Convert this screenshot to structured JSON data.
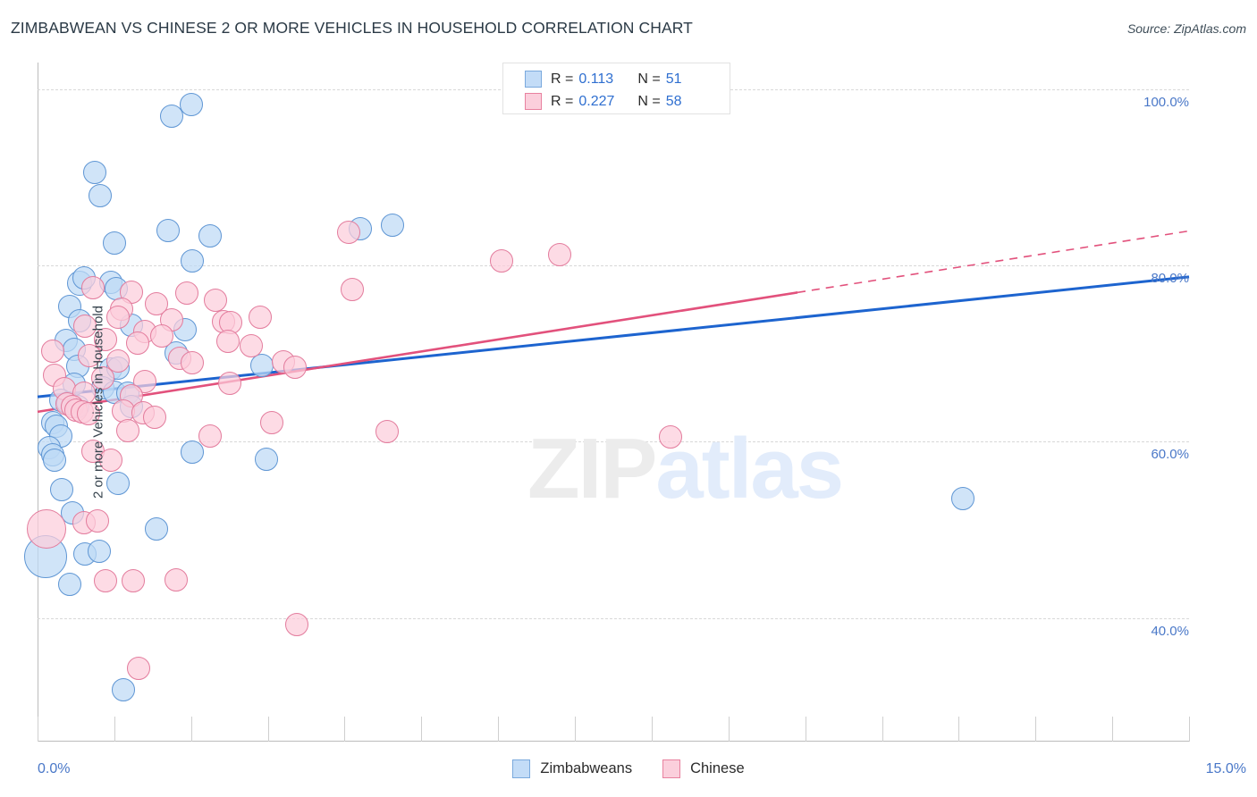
{
  "header": {
    "title": "ZIMBABWEAN VS CHINESE 2 OR MORE VEHICLES IN HOUSEHOLD CORRELATION CHART",
    "source": "Source: ZipAtlas.com"
  },
  "watermark": {
    "part1": "ZIP",
    "part2": "atlas"
  },
  "stats": {
    "rows": [
      {
        "series": "Zimbabweans",
        "r_label": "R =",
        "r_value": "0.113",
        "n_label": "N =",
        "n_value": "51",
        "color": "#c3dcf7"
      },
      {
        "series": "Chinese",
        "r_label": "R =",
        "r_value": "0.227",
        "n_label": "N =",
        "n_value": "58",
        "color": "#fbcfdc"
      }
    ]
  },
  "legend": {
    "items": [
      {
        "label": "Zimbabweans",
        "color": "#c3dcf7",
        "border": "#7aa9dd"
      },
      {
        "label": "Chinese",
        "color": "#fbcfdc",
        "border": "#e8819f"
      }
    ]
  },
  "axes": {
    "x_min_label": "0.0%",
    "x_max_label": "15.0%",
    "y_title": "2 or more Vehicles in Household",
    "y_ticks": [
      "100.0%",
      "80.0%",
      "60.0%",
      "40.0%"
    ]
  },
  "chart_data": {
    "type": "scatter",
    "title": "ZIMBABWEAN VS CHINESE 2 OR MORE VEHICLES IN HOUSEHOLD CORRELATION CHART",
    "xlabel": "",
    "ylabel": "2 or more Vehicles in Household",
    "xlim": [
      0.0,
      15.0
    ],
    "ylim": [
      26.0,
      103.0
    ],
    "x_tick_labels": [
      "0.0%",
      "15.0%"
    ],
    "y_tick_labels": [
      "40.0%",
      "60.0%",
      "80.0%",
      "100.0%"
    ],
    "y_tick_values": [
      40.0,
      60.0,
      80.0,
      100.0
    ],
    "grid": "horizontal-dashed",
    "legend_position": "bottom-center",
    "colors": {
      "zimbabweans_fill": "#bed9f5",
      "zimbabweans_stroke": "#5f96d4",
      "chinese_fill": "#fccddb",
      "chinese_stroke": "#e37c9d"
    },
    "series": [
      {
        "name": "Zimbabweans",
        "r": 0.113,
        "n": 51,
        "trendline": {
          "color": "#1d64cf",
          "x0": 0.0,
          "y0": 65.1,
          "x1": 15.0,
          "y1": 78.7,
          "style": "solid"
        },
        "points": [
          {
            "x": 1.75,
            "y": 96.9,
            "r": 13
          },
          {
            "x": 2.0,
            "y": 98.2,
            "r": 13
          },
          {
            "x": 0.75,
            "y": 90.5,
            "r": 13
          },
          {
            "x": 0.82,
            "y": 87.9,
            "r": 13
          },
          {
            "x": 1.7,
            "y": 84.0,
            "r": 13
          },
          {
            "x": 1.0,
            "y": 82.5,
            "r": 13
          },
          {
            "x": 2.25,
            "y": 83.3,
            "r": 13
          },
          {
            "x": 4.2,
            "y": 84.2,
            "r": 13
          },
          {
            "x": 4.62,
            "y": 84.6,
            "r": 13
          },
          {
            "x": 2.02,
            "y": 80.5,
            "r": 13
          },
          {
            "x": 0.55,
            "y": 78.0,
            "r": 14
          },
          {
            "x": 0.6,
            "y": 78.6,
            "r": 13
          },
          {
            "x": 0.95,
            "y": 78.1,
            "r": 13
          },
          {
            "x": 1.02,
            "y": 77.4,
            "r": 13
          },
          {
            "x": 0.42,
            "y": 75.3,
            "r": 13
          },
          {
            "x": 0.55,
            "y": 73.7,
            "r": 13
          },
          {
            "x": 1.22,
            "y": 73.2,
            "r": 13
          },
          {
            "x": 1.92,
            "y": 72.7,
            "r": 13
          },
          {
            "x": 0.37,
            "y": 71.5,
            "r": 13
          },
          {
            "x": 0.48,
            "y": 70.5,
            "r": 13
          },
          {
            "x": 1.8,
            "y": 70.1,
            "r": 13
          },
          {
            "x": 0.52,
            "y": 68.6,
            "r": 13
          },
          {
            "x": 0.95,
            "y": 68.2,
            "r": 13
          },
          {
            "x": 1.05,
            "y": 68.4,
            "r": 13
          },
          {
            "x": 2.92,
            "y": 68.7,
            "r": 13
          },
          {
            "x": 0.48,
            "y": 66.5,
            "r": 13
          },
          {
            "x": 0.85,
            "y": 66.1,
            "r": 13
          },
          {
            "x": 1.0,
            "y": 65.6,
            "r": 13
          },
          {
            "x": 1.18,
            "y": 65.5,
            "r": 13
          },
          {
            "x": 0.3,
            "y": 64.7,
            "r": 13
          },
          {
            "x": 0.4,
            "y": 64.4,
            "r": 13
          },
          {
            "x": 0.52,
            "y": 64.0,
            "r": 13
          },
          {
            "x": 1.22,
            "y": 64.0,
            "r": 13
          },
          {
            "x": 0.2,
            "y": 62.2,
            "r": 13
          },
          {
            "x": 0.25,
            "y": 61.8,
            "r": 13
          },
          {
            "x": 0.3,
            "y": 60.7,
            "r": 13
          },
          {
            "x": 0.15,
            "y": 59.3,
            "r": 13
          },
          {
            "x": 0.2,
            "y": 58.5,
            "r": 13
          },
          {
            "x": 0.22,
            "y": 57.9,
            "r": 13
          },
          {
            "x": 2.02,
            "y": 58.8,
            "r": 13
          },
          {
            "x": 2.98,
            "y": 58.0,
            "r": 13
          },
          {
            "x": 0.32,
            "y": 54.6,
            "r": 13
          },
          {
            "x": 1.05,
            "y": 55.3,
            "r": 13
          },
          {
            "x": 0.45,
            "y": 51.9,
            "r": 13
          },
          {
            "x": 1.55,
            "y": 50.1,
            "r": 13
          },
          {
            "x": 0.1,
            "y": 47.0,
            "r": 24
          },
          {
            "x": 0.62,
            "y": 47.3,
            "r": 13
          },
          {
            "x": 0.8,
            "y": 47.6,
            "r": 13
          },
          {
            "x": 0.42,
            "y": 43.8,
            "r": 13
          },
          {
            "x": 1.12,
            "y": 31.9,
            "r": 13
          },
          {
            "x": 12.05,
            "y": 53.6,
            "r": 13
          }
        ]
      },
      {
        "name": "Chinese",
        "r": 0.227,
        "n": 58,
        "trendline": {
          "color": "#e2517c",
          "x0": 0.0,
          "y0": 63.4,
          "x1": 15.0,
          "y1": 83.9,
          "style": "solid-then-dashed",
          "dash_start_x": 9.9
        },
        "points": [
          {
            "x": 4.05,
            "y": 83.8,
            "r": 13
          },
          {
            "x": 6.05,
            "y": 80.5,
            "r": 13
          },
          {
            "x": 6.8,
            "y": 81.2,
            "r": 13
          },
          {
            "x": 4.1,
            "y": 77.3,
            "r": 13
          },
          {
            "x": 0.72,
            "y": 77.5,
            "r": 13
          },
          {
            "x": 1.22,
            "y": 77.0,
            "r": 13
          },
          {
            "x": 1.95,
            "y": 76.9,
            "r": 13
          },
          {
            "x": 2.32,
            "y": 76.0,
            "r": 13
          },
          {
            "x": 1.55,
            "y": 75.6,
            "r": 13
          },
          {
            "x": 1.1,
            "y": 75.0,
            "r": 13
          },
          {
            "x": 1.05,
            "y": 74.1,
            "r": 13
          },
          {
            "x": 1.75,
            "y": 73.8,
            "r": 13
          },
          {
            "x": 2.42,
            "y": 73.6,
            "r": 13
          },
          {
            "x": 2.52,
            "y": 73.5,
            "r": 13
          },
          {
            "x": 2.9,
            "y": 74.1,
            "r": 13
          },
          {
            "x": 0.62,
            "y": 73.1,
            "r": 13
          },
          {
            "x": 1.4,
            "y": 72.5,
            "r": 13
          },
          {
            "x": 1.62,
            "y": 72.0,
            "r": 13
          },
          {
            "x": 0.88,
            "y": 71.6,
            "r": 13
          },
          {
            "x": 1.3,
            "y": 71.2,
            "r": 13
          },
          {
            "x": 2.48,
            "y": 71.4,
            "r": 13
          },
          {
            "x": 2.78,
            "y": 70.9,
            "r": 13
          },
          {
            "x": 0.2,
            "y": 70.3,
            "r": 13
          },
          {
            "x": 0.68,
            "y": 69.8,
            "r": 13
          },
          {
            "x": 1.05,
            "y": 69.2,
            "r": 13
          },
          {
            "x": 1.85,
            "y": 69.5,
            "r": 13
          },
          {
            "x": 2.02,
            "y": 69.0,
            "r": 13
          },
          {
            "x": 3.2,
            "y": 69.1,
            "r": 13
          },
          {
            "x": 3.35,
            "y": 68.5,
            "r": 13
          },
          {
            "x": 0.22,
            "y": 67.5,
            "r": 13
          },
          {
            "x": 0.85,
            "y": 67.2,
            "r": 13
          },
          {
            "x": 1.4,
            "y": 66.8,
            "r": 13
          },
          {
            "x": 2.5,
            "y": 66.6,
            "r": 13
          },
          {
            "x": 0.35,
            "y": 66.0,
            "r": 13
          },
          {
            "x": 0.6,
            "y": 65.5,
            "r": 13
          },
          {
            "x": 1.22,
            "y": 65.2,
            "r": 13
          },
          {
            "x": 0.38,
            "y": 64.3,
            "r": 13
          },
          {
            "x": 0.45,
            "y": 64.0,
            "r": 13
          },
          {
            "x": 0.5,
            "y": 63.6,
            "r": 13
          },
          {
            "x": 0.58,
            "y": 63.4,
            "r": 13
          },
          {
            "x": 0.66,
            "y": 63.2,
            "r": 13
          },
          {
            "x": 1.12,
            "y": 63.5,
            "r": 13
          },
          {
            "x": 1.38,
            "y": 63.3,
            "r": 13
          },
          {
            "x": 1.52,
            "y": 62.8,
            "r": 13
          },
          {
            "x": 3.05,
            "y": 62.2,
            "r": 13
          },
          {
            "x": 1.18,
            "y": 61.3,
            "r": 13
          },
          {
            "x": 2.25,
            "y": 60.6,
            "r": 13
          },
          {
            "x": 4.55,
            "y": 61.2,
            "r": 13
          },
          {
            "x": 8.25,
            "y": 60.5,
            "r": 13
          },
          {
            "x": 0.72,
            "y": 58.9,
            "r": 13
          },
          {
            "x": 0.95,
            "y": 57.9,
            "r": 13
          },
          {
            "x": 0.12,
            "y": 50.1,
            "r": 22
          },
          {
            "x": 0.6,
            "y": 50.8,
            "r": 13
          },
          {
            "x": 0.78,
            "y": 51.0,
            "r": 13
          },
          {
            "x": 0.88,
            "y": 44.2,
            "r": 13
          },
          {
            "x": 1.25,
            "y": 44.2,
            "r": 13
          },
          {
            "x": 1.8,
            "y": 44.3,
            "r": 13
          },
          {
            "x": 3.38,
            "y": 39.3,
            "r": 13
          },
          {
            "x": 1.32,
            "y": 34.3,
            "r": 13
          }
        ]
      }
    ]
  }
}
